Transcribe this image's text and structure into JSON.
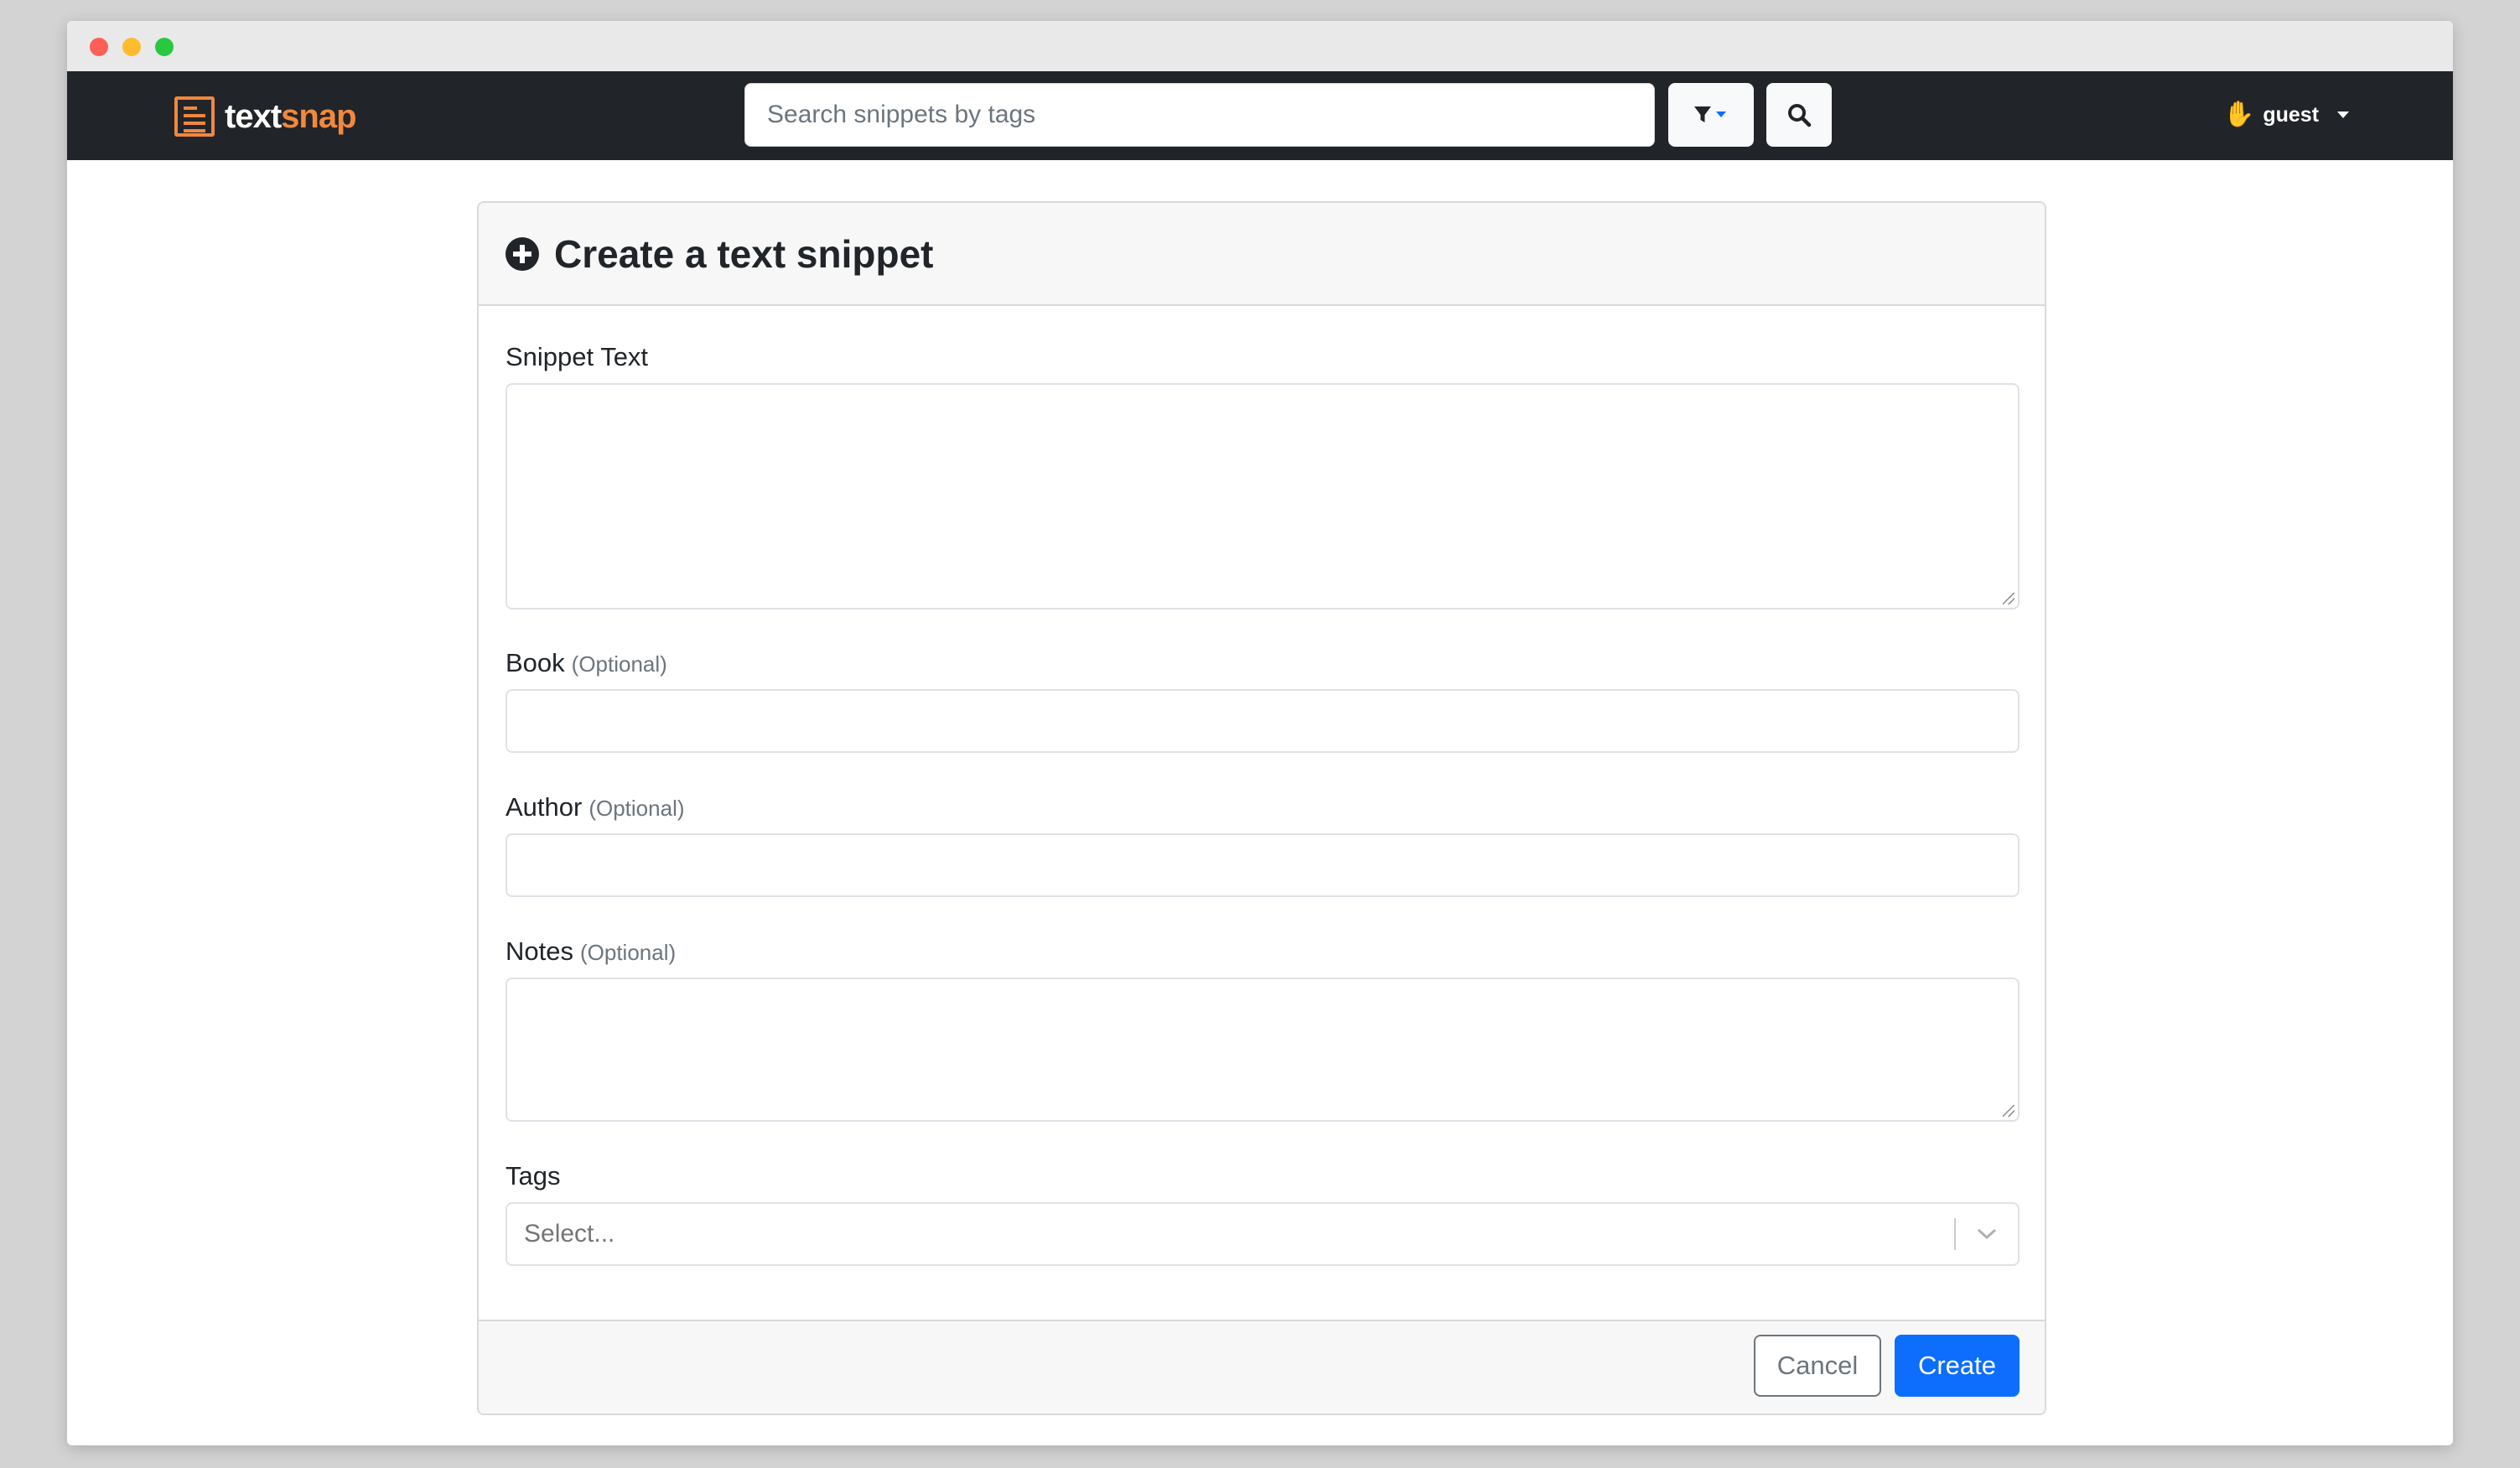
{
  "app": {
    "brand_part1": "text",
    "brand_part2": "snap",
    "brand_color": "#f0883e"
  },
  "header": {
    "search_placeholder": "Search snippets by tags",
    "filter_icon": "filter-icon",
    "search_icon": "search-icon",
    "user_icon": "raised-hand-icon",
    "user_name": "guest"
  },
  "form": {
    "title": "Create a text snippet",
    "title_icon": "plus-circle-icon",
    "snippet_text_label": "Snippet Text",
    "book_label": "Book",
    "author_label": "Author",
    "notes_label": "Notes",
    "optional_hint": "(Optional)",
    "tags_label": "Tags",
    "tags_placeholder": "Select...",
    "snippet_text_value": "",
    "book_value": "",
    "author_value": "",
    "notes_value": ""
  },
  "footer": {
    "cancel_label": "Cancel",
    "create_label": "Create",
    "primary_color": "#0d6efd"
  }
}
